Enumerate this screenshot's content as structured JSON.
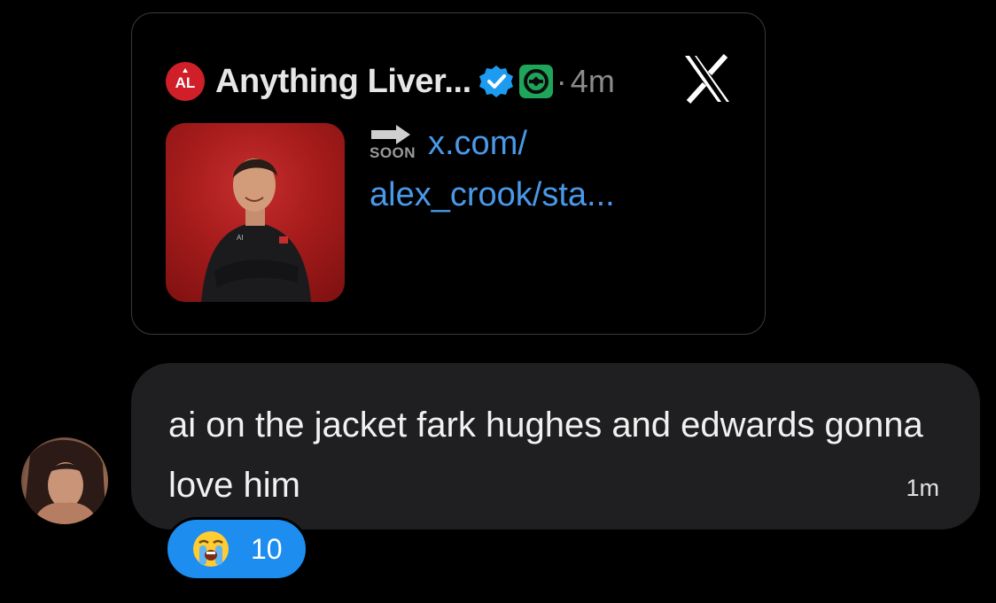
{
  "quote_card": {
    "author_name": "Anything Liver...",
    "avatar_letters": "AL",
    "time_separator": "·",
    "time": "4m",
    "x_logo_icon": "x-logo-icon",
    "verified_icon": "verified-badge-icon",
    "affiliate_icon": "affiliate-badge-icon",
    "media_icon": "photo-thumbnail",
    "soon_label": "SOON",
    "link_line1": "x.com/",
    "link_line2": "alex_crook/sta..."
  },
  "message": {
    "text": "ai on the jacket fark hughes and edwards gonna love him",
    "time": "1m"
  },
  "reaction": {
    "emoji_icon": "loudly-crying-face-icon",
    "count": "10"
  },
  "colors": {
    "background": "#000000",
    "bubble": "#1f1f21",
    "link": "#4a99e9",
    "reaction": "#1d8df0",
    "verified": "#1d9bf0",
    "brand_red": "#d11f2a"
  }
}
